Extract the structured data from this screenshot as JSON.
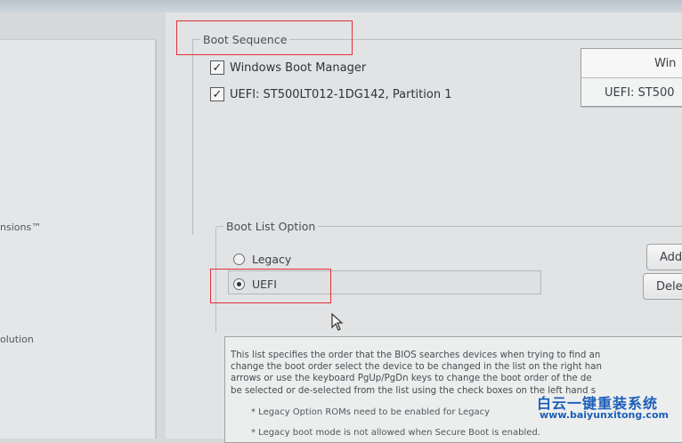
{
  "left_panel": {
    "items": [
      {
        "label": "nsions™"
      },
      {
        "label": "olution"
      }
    ]
  },
  "boot_sequence": {
    "title": "Boot Sequence",
    "items": [
      {
        "label": "Windows Boot Manager",
        "checked": true
      },
      {
        "label": "UEFI: ST500LT012-1DG142, Partition 1",
        "checked": true
      }
    ],
    "order_table": [
      "Win",
      "UEFI: ST500"
    ]
  },
  "boot_list_option": {
    "title": "Boot List Option",
    "options": [
      {
        "label": "Legacy",
        "selected": false
      },
      {
        "label": "UEFI",
        "selected": true
      }
    ],
    "buttons": {
      "add": "Add",
      "delete": "Delete"
    }
  },
  "help": {
    "lines": [
      "This list specifies the order that the BIOS searches devices when trying to find an",
      "change the boot order select the device to be changed in the list on the right han",
      "arrows or use the keyboard PgUp/PgDn keys to change the boot order of the de",
      "be selected or de-selected from the list using the check boxes on the left hand s"
    ],
    "note1": "* Legacy Option ROMs need to be enabled for Legacy",
    "note2": "* Legacy boot mode is not allowed when Secure Boot is enabled."
  },
  "watermark": {
    "name": "白云一键重装系统",
    "url": "www.baiyunxitong.com"
  },
  "colors": {
    "annotation": "#e0303a",
    "watermark": "#1b5fb8"
  }
}
